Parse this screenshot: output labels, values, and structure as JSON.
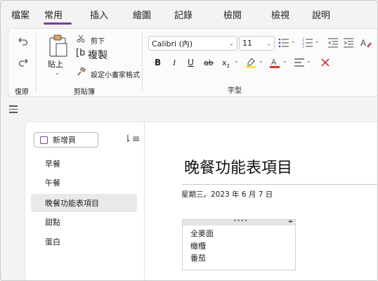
{
  "tabs": [
    "檔案",
    "常用",
    "插入",
    "繪圖",
    "記錄",
    "檢閱",
    "檢視",
    "說明"
  ],
  "ribbon": {
    "undo_group_label": "復原",
    "paste_label": "貼上",
    "cut_label": "剪下",
    "copy_label": "複製",
    "format_painter_label": "設定小畫家格式",
    "clipboard_group_label": "剪貼簿",
    "font_name": "Calibri (內)",
    "font_size": "11",
    "font_group_label": "字型",
    "colors": {
      "highlight": "#f5e43b",
      "font": "#e0302a",
      "clear": "#d13438"
    }
  },
  "pagelist": {
    "add_page_label": "新增頁",
    "pages": [
      "早餐",
      "午餐",
      "晚餐功能表項目",
      "甜點",
      "蛋白"
    ],
    "selected_index": 2
  },
  "page": {
    "title": "晚餐功能表項目",
    "date": "星期三。2023 年 6 月 7 日",
    "note_lines": [
      "全麥面",
      "橄欖",
      "番茄"
    ]
  },
  "accent": "#7a3e9d"
}
